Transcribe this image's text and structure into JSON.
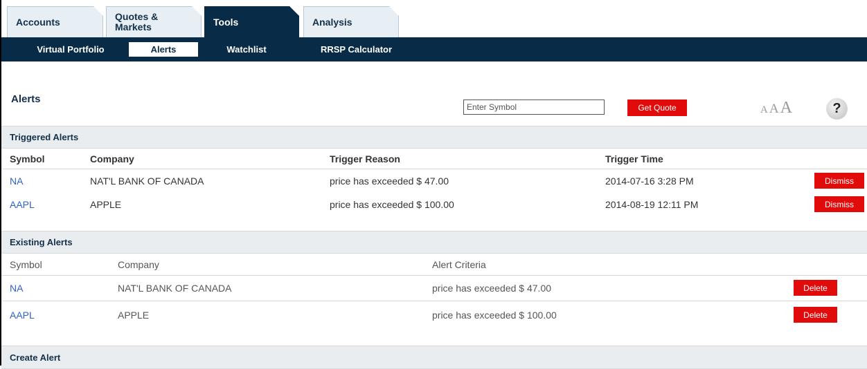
{
  "tabs": [
    {
      "label": "Accounts",
      "active": false
    },
    {
      "label": "Quotes & Markets",
      "active": false
    },
    {
      "label": "Tools",
      "active": true
    },
    {
      "label": "Analysis",
      "active": false
    }
  ],
  "subnav": [
    {
      "label": "Virtual Portfolio",
      "active": false
    },
    {
      "label": "Alerts",
      "active": true
    },
    {
      "label": "Watchlist",
      "active": false
    },
    {
      "label": "RRSP Calculator",
      "active": false
    }
  ],
  "page_title": "Alerts",
  "quote": {
    "placeholder": "Enter Symbol",
    "button_label": "Get Quote"
  },
  "font_size_control": {
    "small": "A",
    "medium": "A",
    "large": "A"
  },
  "help_icon": "?",
  "triggered": {
    "title": "Triggered Alerts",
    "headers": {
      "symbol": "Symbol",
      "company": "Company",
      "reason": "Trigger Reason",
      "time": "Trigger Time"
    },
    "rows": [
      {
        "symbol": "NA",
        "company": "NAT'L BANK OF CANADA",
        "reason": "price has exceeded $ 47.00",
        "time": "2014-07-16 3:28 PM",
        "action": "Dismiss"
      },
      {
        "symbol": "AAPL",
        "company": "APPLE",
        "reason": "price has exceeded $ 100.00",
        "time": "2014-08-19 12:11 PM",
        "action": "Dismiss"
      }
    ]
  },
  "existing": {
    "title": "Existing Alerts",
    "headers": {
      "symbol": "Symbol",
      "company": "Company",
      "criteria": "Alert Criteria"
    },
    "rows": [
      {
        "symbol": "NA",
        "company": "NAT'L BANK OF CANADA",
        "criteria": "price has exceeded $ 47.00",
        "action": "Delete"
      },
      {
        "symbol": "AAPL",
        "company": "APPLE",
        "criteria": "price has exceeded $ 100.00",
        "action": "Delete"
      }
    ]
  },
  "create": {
    "title": "Create Alert"
  },
  "colors": {
    "nav_dark": "#082c47",
    "tab_light": "#e8eff4",
    "button_red": "#e20b0b",
    "link_blue": "#2f60c8",
    "section_bg": "#eaedf0"
  }
}
